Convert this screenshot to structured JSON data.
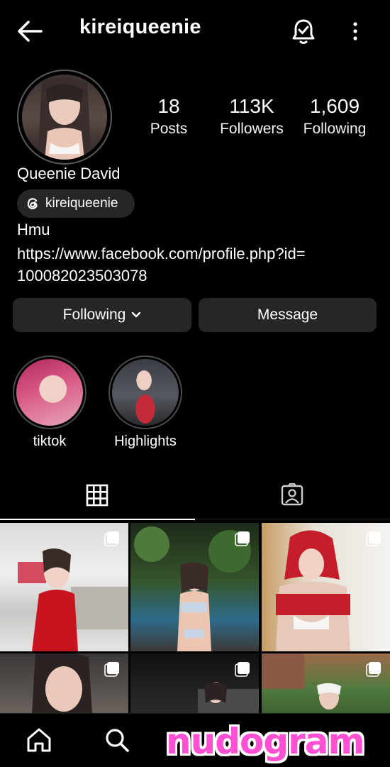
{
  "header": {
    "username": "kireiqueenie",
    "icons": [
      "back-arrow-icon",
      "notification-bell-icon",
      "more-options-icon"
    ]
  },
  "profile": {
    "stats": {
      "posts_count": "18",
      "posts_label": "Posts",
      "followers_count": "113K",
      "followers_label": "Followers",
      "following_count": "1,609",
      "following_label": "Following"
    },
    "display_name": "Queenie David",
    "threads_handle": "kireiqueenie",
    "bio_line": "Hmu",
    "link_line1": "https://www.facebook.com/profile.php?id=",
    "link_line2": "100082023503078"
  },
  "actions": {
    "following_label": "Following",
    "message_label": "Message"
  },
  "highlights": [
    {
      "label": "tiktok"
    },
    {
      "label": "Highlights"
    }
  ],
  "tabs": [
    {
      "name": "posts-grid",
      "icon": "grid-icon",
      "active": true
    },
    {
      "name": "tagged",
      "icon": "tagged-user-icon",
      "active": false
    }
  ],
  "bottom_nav": {
    "icons": [
      "home-icon",
      "search-icon"
    ],
    "watermark": "nudogram"
  },
  "colors": {
    "background": "#000000",
    "button": "#262626",
    "watermark": "#ff4fd2"
  }
}
